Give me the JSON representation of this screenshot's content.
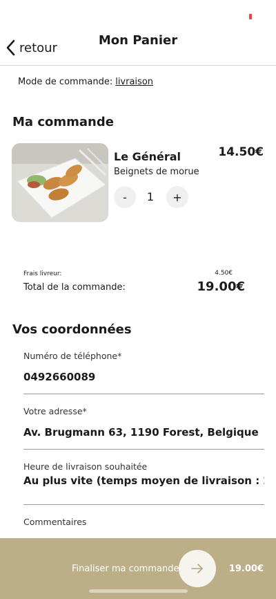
{
  "header": {
    "back_label": "retour",
    "title": "Mon Panier"
  },
  "order_mode": {
    "label": "Mode de commande:",
    "value": "livraison"
  },
  "order": {
    "heading": "Ma commande",
    "item": {
      "name": "Le Général",
      "description": "Beignets de morue",
      "price": "14.50€",
      "quantity": "1",
      "minus": "-",
      "plus": "+"
    },
    "delivery_fee_label": "Frais livreur:",
    "delivery_fee": "4.50€",
    "total_label": "Total de la commande:",
    "total": "19.00€"
  },
  "contact": {
    "heading": "Vos coordonnées",
    "phone_label": "Numéro de téléphone*",
    "phone_value": "0492660089",
    "address_label": "Votre adresse*",
    "address_value": "Av. Brugmann 63, 1190 Forest, Belgique",
    "time_label": "Heure de livraison souhaitée",
    "time_value": "Au plus vite (temps moyen de livraison : 2",
    "comments_label": "Commentaires"
  },
  "footer": {
    "checkout_label": "Finaliser ma commande",
    "total": "19.00€"
  },
  "colors": {
    "accent": "#bcaf88",
    "background": "#ffffff",
    "text": "#1a1a1a",
    "status": "#e8453c"
  }
}
